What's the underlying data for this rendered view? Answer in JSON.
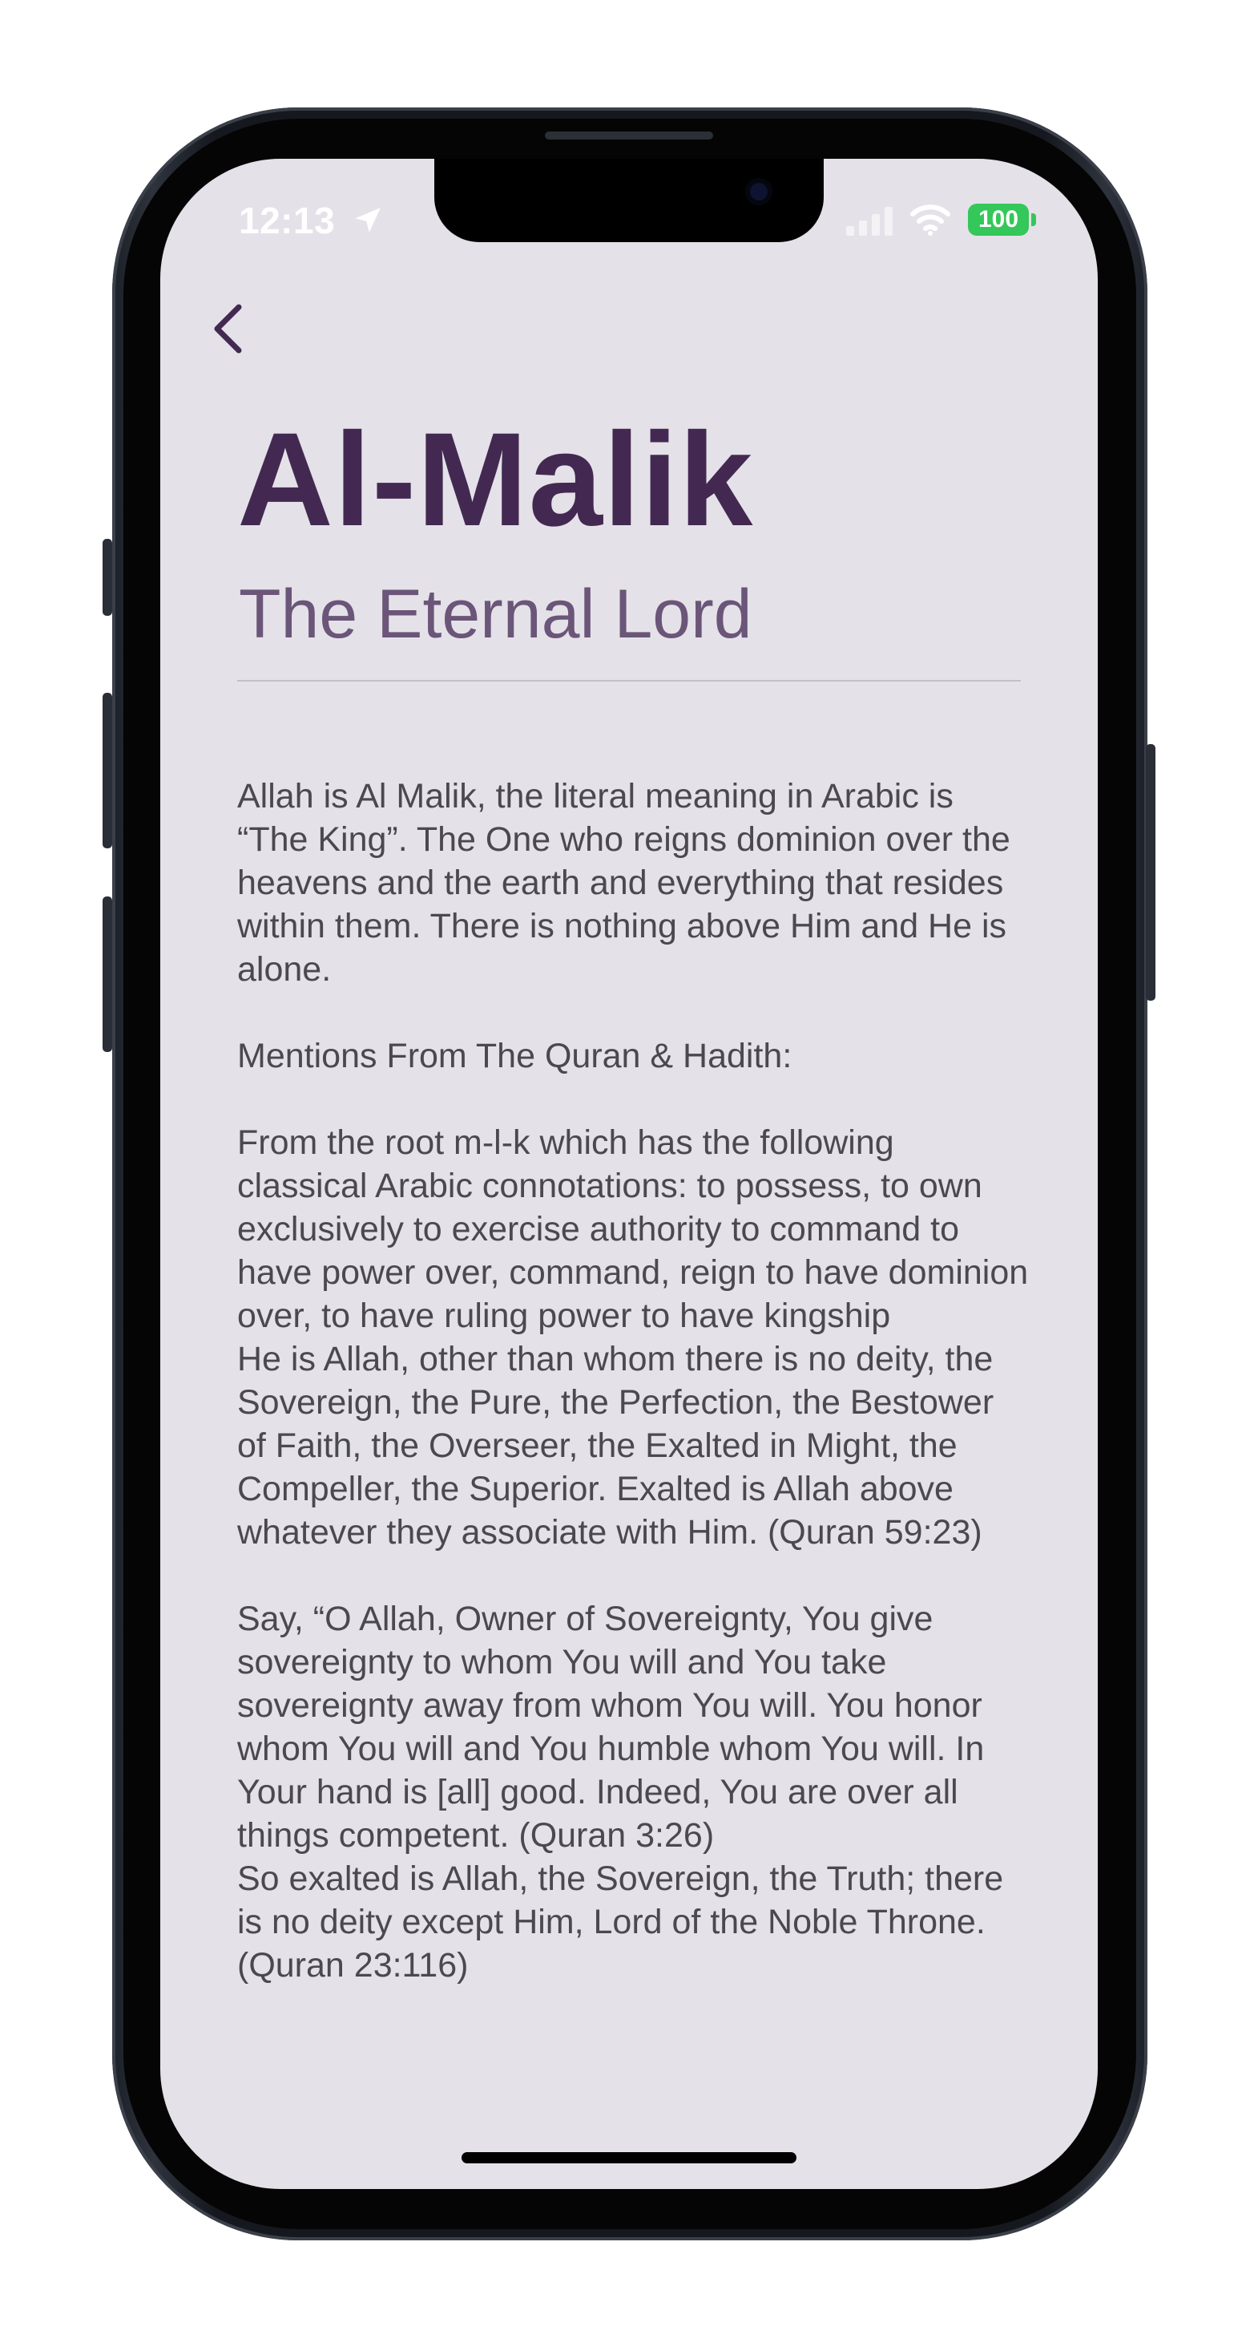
{
  "status_bar": {
    "time": "12:13",
    "battery": "100",
    "icons": [
      "location-arrow-icon",
      "cellular-signal-icon",
      "wifi-icon",
      "battery-icon"
    ],
    "battery_color": "#34c759"
  },
  "nav": {
    "back_icon": "chevron-left-icon"
  },
  "header": {
    "title": "Al-Malik",
    "subtitle": "The Eternal Lord"
  },
  "content": {
    "paragraphs": [
      "Allah is Al Malik, the literal meaning in Arabic is “The King”. The One who reigns dominion over the heavens and the earth and everything that resides within them. There is nothing above Him and He is alone.",
      "Mentions From The Quran & Hadith:",
      "From the root m-l-k which has the following classical Arabic connotations: to possess, to own exclusively to exercise authority to command to have power over, command, reign to have dominion over, to have ruling power to have kingship\nHe is Allah, other than whom there is no deity, the Sovereign, the Pure, the Perfection, the Bestower of Faith, the Overseer, the Exalted in Might, the Compeller, the Superior. Exalted is Allah above whatever they associate with Him. (Quran 59:23)",
      "Say, “O Allah, Owner of Sovereignty, You give sovereignty to whom You will and You take sovereignty away from whom You will. You honor whom You will and You humble whom You will. In Your hand is [all] good. Indeed, You are over all things competent. (Quran 3:26)\nSo exalted is Allah, the Sovereign, the Truth; there is no deity except Him, Lord of the Noble Throne. (Quran 23:116)"
    ]
  },
  "colors": {
    "title": "#432952",
    "subtitle": "#6b5579",
    "background": "#e4e2e8",
    "body_text": "#4a4950"
  }
}
